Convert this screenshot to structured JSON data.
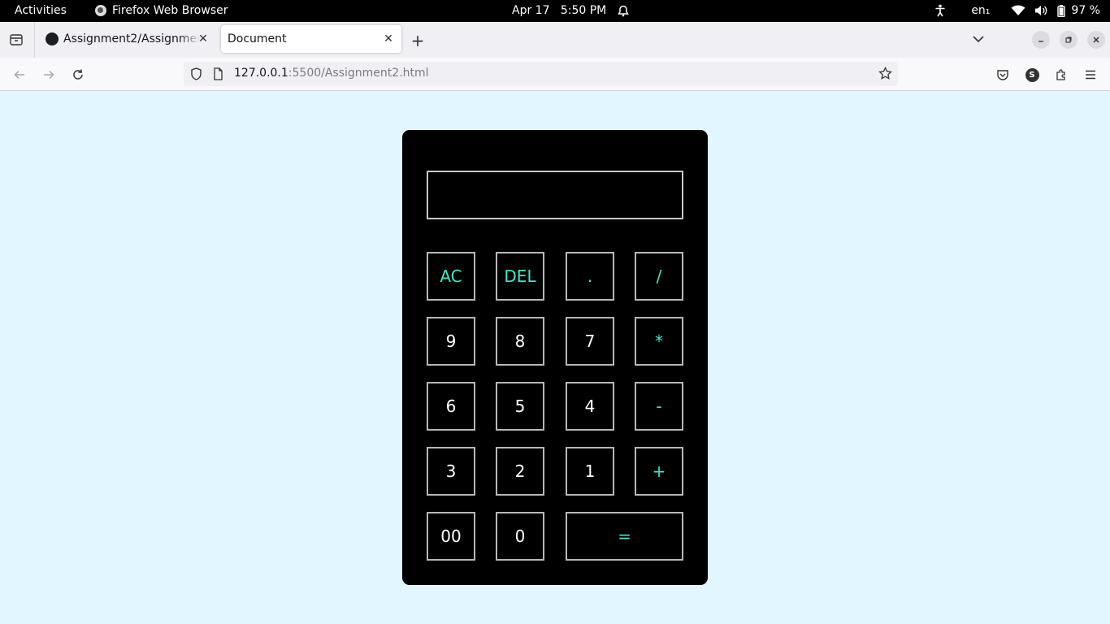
{
  "system": {
    "activities": "Activities",
    "app_name": "Firefox Web Browser",
    "date": "Apr 17",
    "time": "5:50 PM",
    "language": "en₁",
    "battery": "97 %"
  },
  "browser": {
    "tabs": [
      {
        "title": "Assignment2/Assignment"
      },
      {
        "title": "Document"
      }
    ],
    "url_host": "127.0.0.1",
    "url_rest": ":5500/Assignment2.html",
    "profile_initial": "S"
  },
  "calculator": {
    "display_value": "",
    "accent_color": "#3ee8c8",
    "keys": {
      "ac": "AC",
      "del": "DEL",
      "dot": ".",
      "divide": "/",
      "k9": "9",
      "k8": "8",
      "k7": "7",
      "multiply": "*",
      "k6": "6",
      "k5": "5",
      "k4": "4",
      "minus": "-",
      "k3": "3",
      "k2": "2",
      "k1": "1",
      "plus": "+",
      "k00": "00",
      "k0": "0",
      "equals": "="
    }
  }
}
